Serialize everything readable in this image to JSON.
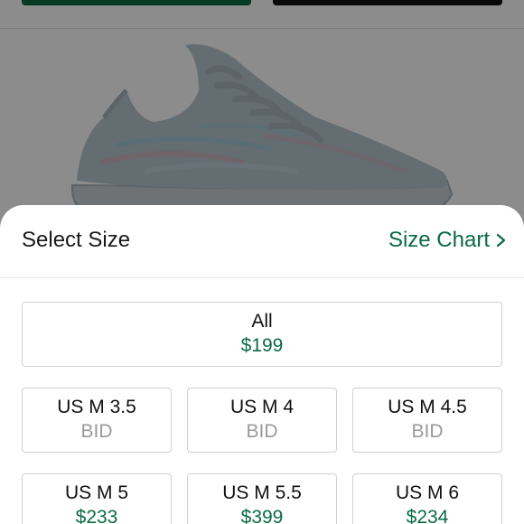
{
  "sheet": {
    "title": "Select Size",
    "size_chart_label": "Size Chart"
  },
  "sizes": {
    "all": {
      "label": "All",
      "price": "$199"
    },
    "row1": [
      {
        "label": "US M 3.5",
        "price": "BID"
      },
      {
        "label": "US M 4",
        "price": "BID"
      },
      {
        "label": "US M 4.5",
        "price": "BID"
      }
    ],
    "row2": [
      {
        "label": "US M 5",
        "price": "$233"
      },
      {
        "label": "US M 5.5",
        "price": "$399"
      },
      {
        "label": "US M 6",
        "price": "$234"
      }
    ]
  },
  "colors": {
    "accent_green": "#0b6b43",
    "bid_gray": "#9a9a9a"
  },
  "icons": {
    "size_chart_chevron": "chevron-right-icon",
    "product": "sneaker-image"
  }
}
